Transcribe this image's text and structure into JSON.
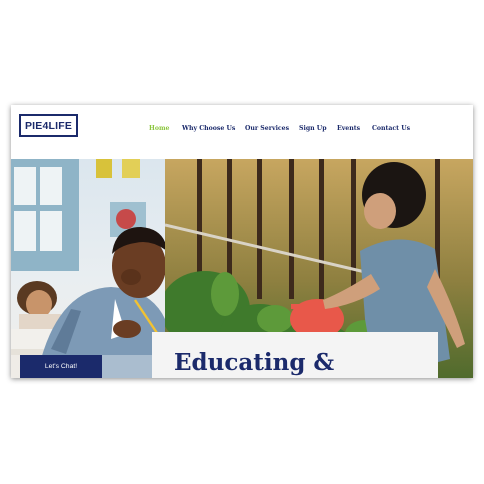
{
  "header": {
    "logo_text": "PIE4LIFE",
    "nav": [
      {
        "label": "Home",
        "active": true
      },
      {
        "label": "Why Choose Us",
        "active": false
      },
      {
        "label": "Our Services",
        "active": false
      },
      {
        "label": "Sign Up",
        "active": false
      },
      {
        "label": "Events",
        "active": false
      },
      {
        "label": "Contact Us",
        "active": false
      }
    ]
  },
  "hero": {
    "headline": "Educating &",
    "cta_label": "Let's Chat!"
  },
  "colors": {
    "brand_navy": "#1b2a6b",
    "nav_active_green": "#8cc63f",
    "card_background": "#f4f4f4"
  }
}
